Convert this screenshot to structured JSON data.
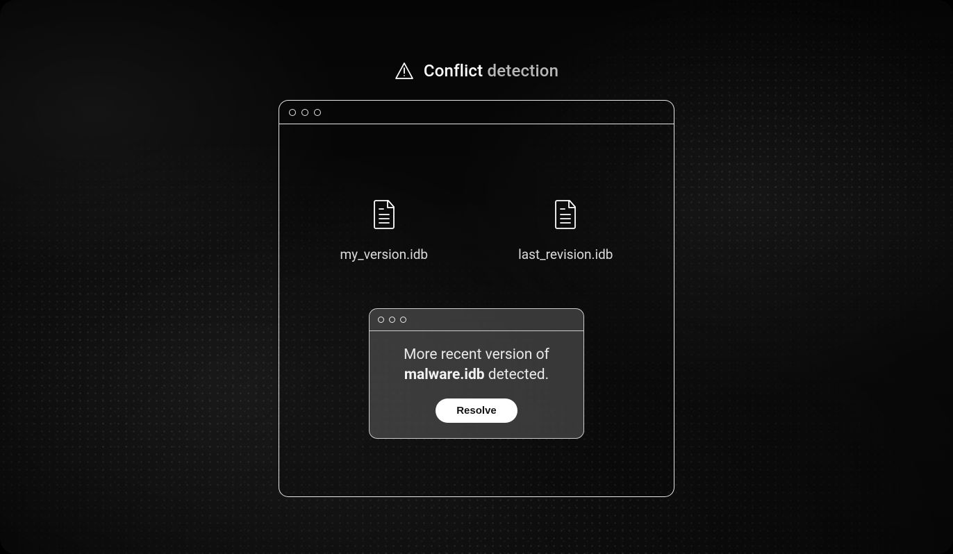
{
  "header": {
    "title_strong": "Conflict",
    "title_fade": "detection"
  },
  "files": [
    {
      "icon": "file-icon",
      "name": "my_version.idb"
    },
    {
      "icon": "file-icon",
      "name": "last_revision.idb"
    }
  ],
  "dialog": {
    "message_prefix": "More recent version of ",
    "message_filename": "malware.idb",
    "message_suffix": " detected.",
    "resolve_label": "Resolve"
  }
}
